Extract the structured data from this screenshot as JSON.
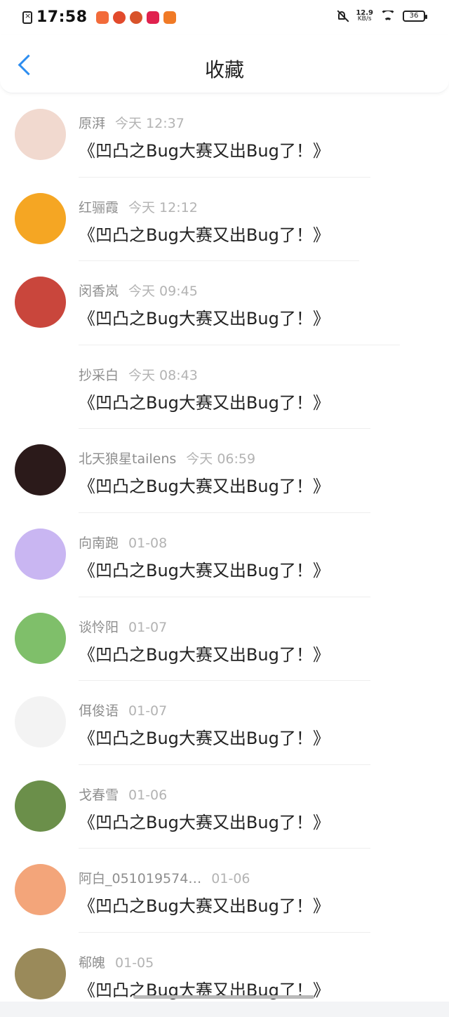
{
  "status_bar": {
    "time": "17:58",
    "network_speed_value": "12.9",
    "network_speed_unit": "KB/s",
    "battery": "36"
  },
  "header": {
    "title": "收藏"
  },
  "items": [
    {
      "name": "原湃",
      "time": "今天 12:37",
      "text": "《凹凸之Bug大赛又出Bug了！》"
    },
    {
      "name": "红骊霞",
      "time": "今天 12:12",
      "text": "《凹凸之Bug大赛又出Bug了！》"
    },
    {
      "name": "闵香岚",
      "time": "今天 09:45",
      "text": "《凹凸之Bug大赛又出Bug了！》"
    },
    {
      "name": "抄采白",
      "time": "今天 08:43",
      "text": "《凹凸之Bug大赛又出Bug了！》"
    },
    {
      "name": "北天狼星tailens",
      "time": "今天 06:59",
      "text": "《凹凸之Bug大赛又出Bug了！》"
    },
    {
      "name": "向南跑",
      "time": "01-08",
      "text": "《凹凸之Bug大赛又出Bug了！》"
    },
    {
      "name": "谈怜阳",
      "time": "01-07",
      "text": "《凹凸之Bug大赛又出Bug了！》"
    },
    {
      "name": "佴俊语",
      "time": "01-07",
      "text": "《凹凸之Bug大赛又出Bug了！》"
    },
    {
      "name": "戈春雪",
      "time": "01-06",
      "text": "《凹凸之Bug大赛又出Bug了！》"
    },
    {
      "name": "阿白_051019574…",
      "time": "01-06",
      "text": "《凹凸之Bug大赛又出Bug了！》"
    },
    {
      "name": "郗魄",
      "time": "01-05",
      "text": "《凹凸之Bug大赛又出Bug了！》"
    }
  ],
  "avatar_colors": [
    "#f1d9cf",
    "#f5a623",
    "#c9463c",
    "#ffffff",
    "#2b1a1a",
    "#c9b6f2",
    "#7fbf6a",
    "#f3f3f3",
    "#6b8f4a",
    "#f3a57a",
    "#9a8a5a"
  ]
}
